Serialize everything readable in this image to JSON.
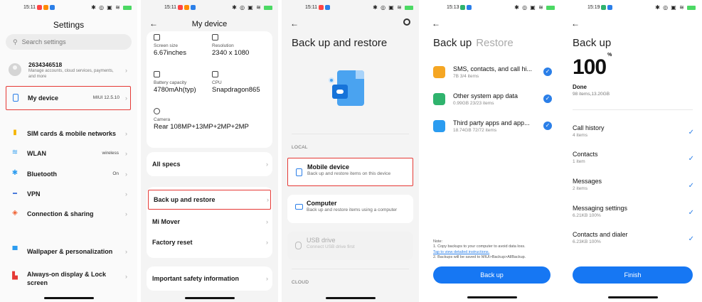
{
  "colors": {
    "accent": "#1677f3",
    "highlight": "#e53935"
  },
  "screens": {
    "settings": {
      "time": "15:11",
      "title": "Settings",
      "search_placeholder": "Search settings",
      "account": {
        "name": "2634346518",
        "sub": "Manage accounts, cloud services, payments, and more"
      },
      "my_device": {
        "label": "My device",
        "value": "MIUI 12.5.10"
      },
      "items": [
        {
          "label": "SIM cards & mobile networks",
          "value": "",
          "icon": "sim-card-icon"
        },
        {
          "label": "WLAN",
          "value": "wireless",
          "icon": "wifi-icon"
        },
        {
          "label": "Bluetooth",
          "value": "On",
          "icon": "bluetooth-icon"
        },
        {
          "label": "VPN",
          "value": "",
          "icon": "vpn-icon"
        },
        {
          "label": "Connection & sharing",
          "value": "",
          "icon": "connection-icon"
        },
        {
          "label": "Wallpaper & personalization",
          "value": "",
          "icon": "wallpaper-icon"
        },
        {
          "label": "Always-on display & Lock screen",
          "value": "",
          "icon": "lock-icon"
        }
      ]
    },
    "my_device": {
      "time": "15:11",
      "title": "My device",
      "specs": [
        {
          "key": "Screen size",
          "value": "6.67inches"
        },
        {
          "key": "Resolution",
          "value": "2340 x 1080"
        },
        {
          "key": "Battery capacity",
          "value": "4780mAh(typ)"
        },
        {
          "key": "CPU",
          "value": "Snapdragon865"
        },
        {
          "key": "Camera",
          "value": "Rear 108MP+13MP+2MP+2MP"
        }
      ],
      "all_specs": "All specs",
      "menu": [
        "Back up and restore",
        "Mi Mover",
        "Factory reset"
      ],
      "safety": "Important safety information"
    },
    "backup_restore": {
      "time": "15:11",
      "title": "Back up and restore",
      "local_label": "LOCAL",
      "cloud_label": "CLOUD",
      "options": [
        {
          "label": "Mobile device",
          "sub": "Back up and restore items on this device"
        },
        {
          "label": "Computer",
          "sub": "Back up and restore items using a computer"
        },
        {
          "label": "USB drive",
          "sub": "Connect USB drive first"
        }
      ]
    },
    "backup_select": {
      "time": "15:13",
      "tab_backup": "Back up",
      "tab_restore": "Restore",
      "items": [
        {
          "label": "SMS, contacts, and call hi...",
          "sub": "7B  3/4 items",
          "color": "#f5a623"
        },
        {
          "label": "Other system app data",
          "sub": "0.99GB  23/23 items",
          "color": "#2fb36d"
        },
        {
          "label": "Third party apps and app...",
          "sub": "18.74GB  72/72 items",
          "color": "#2b9cf0"
        }
      ],
      "note_title": "Note:",
      "note_1": "1. Copy backups to your computer to avoid data loss.",
      "note_link": "Tap to view detailed instructions.",
      "note_2": "2. Backups will be saved to MIUI>Backup>AllBackup.",
      "button": "Back up"
    },
    "backup_progress": {
      "time": "15:19",
      "title": "Back up",
      "progress": "100",
      "progress_unit": "%",
      "status": "Done",
      "summary": "98 items,13.20GB",
      "items": [
        {
          "label": "Call history",
          "sub": "4 items"
        },
        {
          "label": "Contacts",
          "sub": "1 item"
        },
        {
          "label": "Messages",
          "sub": "2 items"
        },
        {
          "label": "Messaging settings",
          "sub": "6.21KB 100%"
        },
        {
          "label": "Contacts and dialer",
          "sub": "6.23KB 100%"
        }
      ],
      "button": "Finish"
    }
  }
}
